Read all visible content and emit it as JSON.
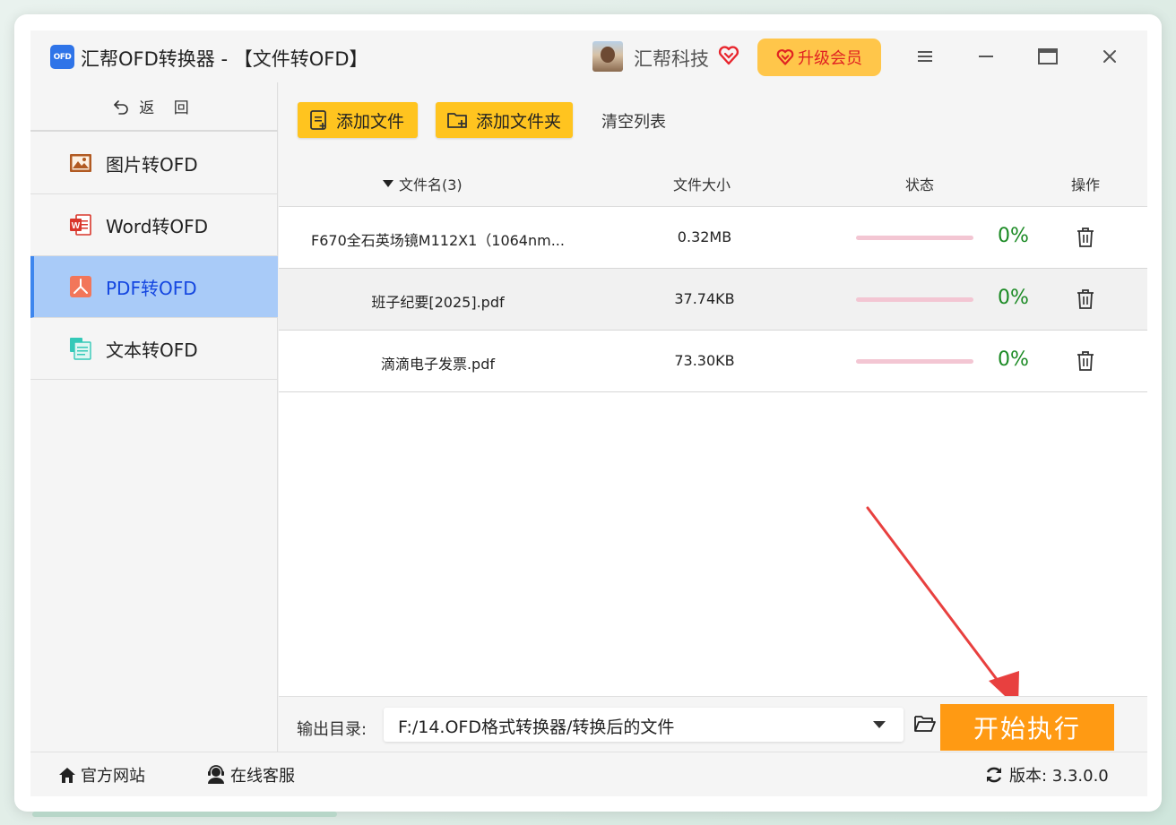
{
  "app": {
    "logo_text": "OFD",
    "title": "汇帮OFD转换器 - 【文件转OFD】",
    "user_name": "汇帮科技",
    "upgrade_label": "升级会员"
  },
  "sidebar": {
    "back_label": "返 回",
    "items": [
      {
        "label": "图片转OFD",
        "icon": "image-icon"
      },
      {
        "label": "Word转OFD",
        "icon": "word-icon"
      },
      {
        "label": "PDF转OFD",
        "icon": "pdf-icon",
        "active": true
      },
      {
        "label": "文本转OFD",
        "icon": "text-file-icon"
      }
    ]
  },
  "toolbar": {
    "add_file_label": "添加文件",
    "add_folder_label": "添加文件夹",
    "clear_label": "清空列表"
  },
  "table": {
    "headers": {
      "name": "文件名(3)",
      "size": "文件大小",
      "status": "状态",
      "action": "操作"
    },
    "rows": [
      {
        "name": "F670全石英场镜M112X1（1064nm...",
        "size": "0.32MB",
        "progress": 0,
        "percent": "0%"
      },
      {
        "name": "班子纪要[2025].pdf",
        "size": "37.74KB",
        "progress": 0,
        "percent": "0%"
      },
      {
        "name": "滴滴电子发票.pdf",
        "size": "73.30KB",
        "progress": 0,
        "percent": "0%"
      }
    ]
  },
  "output": {
    "label": "输出目录:",
    "path": "F:/14.OFD格式转换器/转换后的文件",
    "start_label": "开始执行"
  },
  "footer": {
    "website_label": "官方网站",
    "support_label": "在线客服",
    "version_label": "版本: 3.3.0.0"
  },
  "colors": {
    "accent": "#ffc41f",
    "start_button": "#ff9a13",
    "active_nav": "#a9cbf8",
    "percent_text": "#1b8a24",
    "annotation_arrow": "#e8403f"
  }
}
